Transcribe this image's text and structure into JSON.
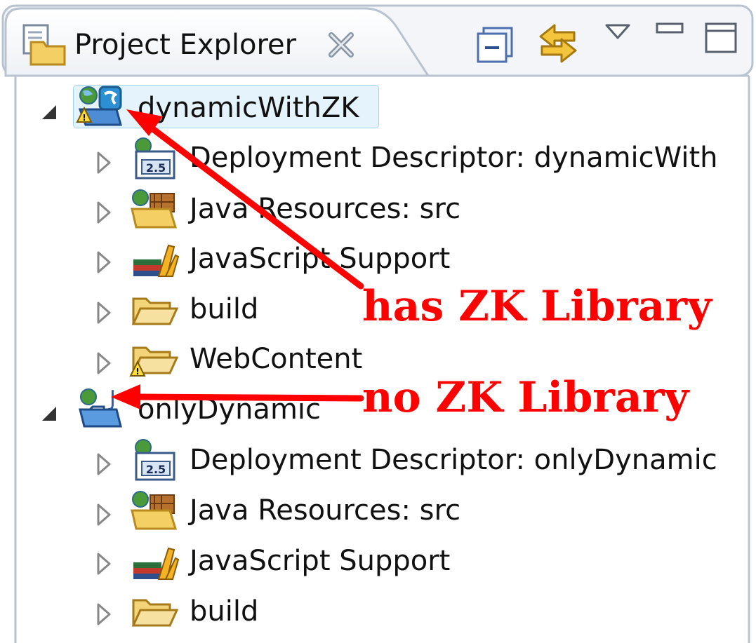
{
  "view": {
    "title": "Project Explorer",
    "icons": [
      "project-explorer-icon",
      "close-icon",
      "collapse-all-icon",
      "link-with-editor-icon",
      "view-menu-icon",
      "minimize-icon",
      "maximize-icon"
    ]
  },
  "tree": {
    "projects": [
      {
        "label": "dynamicWithZK",
        "icon": "web-project-warning-icon",
        "expanded": true,
        "children": [
          {
            "label": "Deployment Descriptor: dynamicWith",
            "icon": "deployment-descriptor-icon"
          },
          {
            "label": "Java Resources: src",
            "icon": "java-resources-icon"
          },
          {
            "label": "JavaScript Support",
            "icon": "javascript-support-icon"
          },
          {
            "label": "build",
            "icon": "folder-icon"
          },
          {
            "label": "WebContent",
            "icon": "folder-warning-icon"
          }
        ]
      },
      {
        "label": "onlyDynamic",
        "icon": "dynamic-web-project-icon",
        "expanded": true,
        "children": [
          {
            "label": "Deployment Descriptor: onlyDynamic",
            "icon": "deployment-descriptor-icon"
          },
          {
            "label": "Java Resources: src",
            "icon": "java-resources-icon"
          },
          {
            "label": "JavaScript Support",
            "icon": "javascript-support-icon"
          },
          {
            "label": "build",
            "icon": "folder-icon"
          }
        ]
      }
    ]
  },
  "annotations": {
    "top": "has ZK Library",
    "bottom": "no ZK Library",
    "color": "#ff0000"
  }
}
